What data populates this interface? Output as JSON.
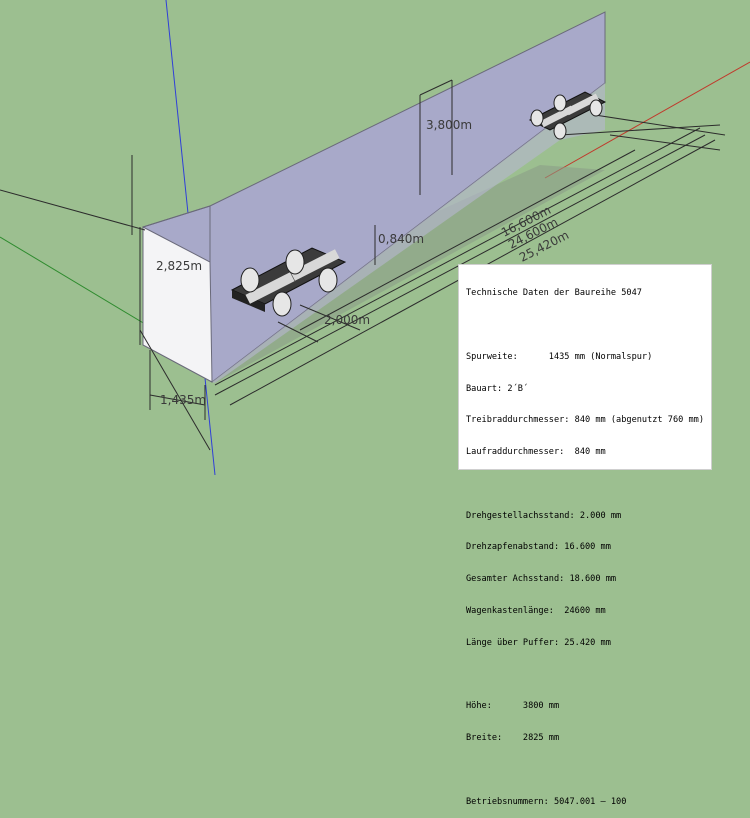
{
  "dimension_labels": {
    "height": "3,800m",
    "width": "2,825m",
    "gauge": "1,435m",
    "wheelbase_bogie": "2,000m",
    "wheel_diameter": "0,840m",
    "pivot_distance": "16,600m",
    "body_length": "24,600m",
    "length_over_buffers": "25,420m"
  },
  "info_panel": {
    "title": "Technische Daten der Baureihe 5047",
    "spurweite": "Spurweite:      1435 mm (Normalspur)",
    "bauart": "Bauart: 2´B´",
    "treibrad": "Treibraddurchmesser: 840 mm (abgenutzt 760 mm)",
    "laufrad": "Laufraddurchmesser:  840 mm",
    "drehgestell": "Drehgestellachsstand: 2.000 mm",
    "drehzapfen": "Drehzapfenabstand: 16.600 mm",
    "achsstand": "Gesamter Achsstand: 18.600 mm",
    "wagenkasten": "Wagenkastenlänge:  24600 mm",
    "puffer": "Länge über Puffer: 25.420 mm",
    "hoehe": "Höhe:      3800 mm",
    "breite": "Breite:    2825 mm",
    "betriebsnummern": "Betriebsnummern: 5047.001 – 100"
  },
  "colors": {
    "ground": "#9cbf90",
    "body_side": "#a8a9c9",
    "body_end": "#f4f4f6",
    "axis_blue": "#2f3fd8",
    "axis_red": "#c0392b",
    "axis_green": "#2e8b2e"
  }
}
